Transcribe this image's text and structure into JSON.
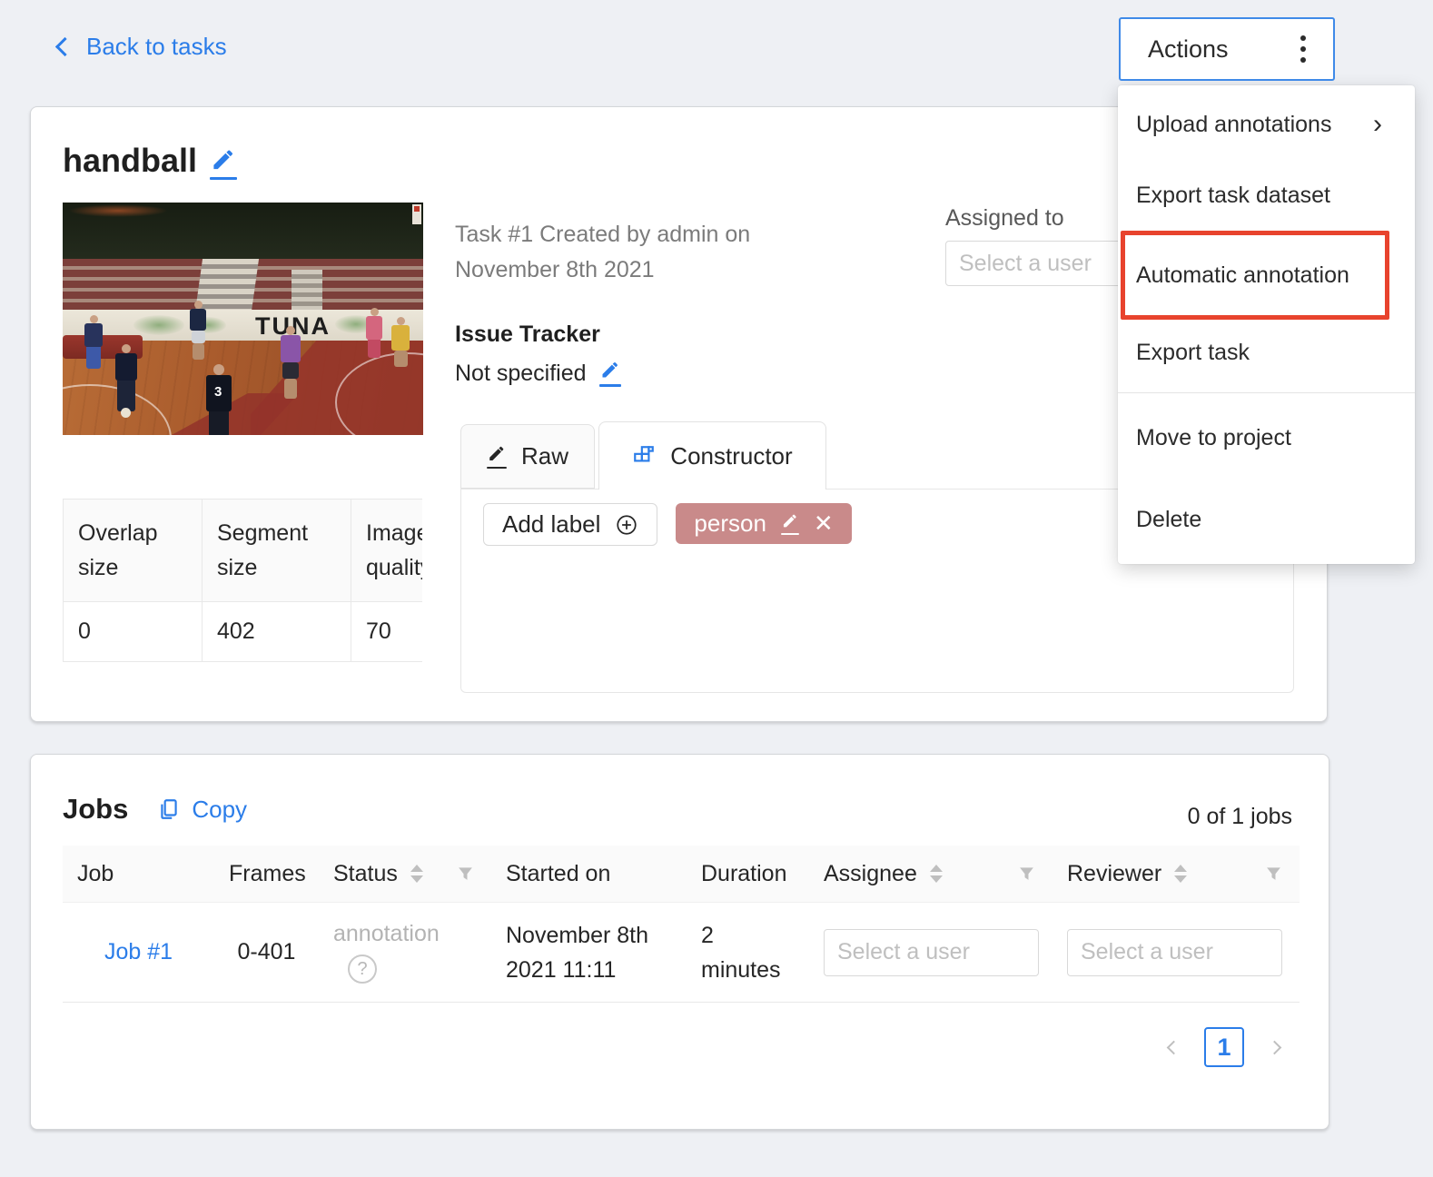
{
  "header": {
    "back_link": "Back to tasks",
    "actions_button": "Actions"
  },
  "actions_menu": {
    "highlight_color": "#e8432d",
    "highlighted_item": "Automatic annotation",
    "items": [
      {
        "label": "Upload annotations"
      },
      {
        "label": "Export task dataset"
      },
      {
        "label": "Automatic annotation"
      },
      {
        "label": "Export task"
      },
      {
        "label": "Move to project"
      },
      {
        "label": "Delete"
      }
    ]
  },
  "task": {
    "title": "handball",
    "created_line1": "Task #1 Created by admin on",
    "created_line2": "November 8th 2021",
    "assigned_to": {
      "label": "Assigned to",
      "placeholder": "Select a user"
    },
    "issue_tracker": {
      "label": "Issue Tracker",
      "value": "Not specified"
    },
    "preview": {
      "banner_text": "TUNA",
      "jersey_number": "3"
    },
    "tabs": {
      "raw": "Raw",
      "constructor": "Constructor"
    },
    "labels_panel": {
      "add_button": "Add label",
      "label_chip": "person",
      "chip_color": "#c98a8a"
    },
    "params_table": {
      "headers": [
        "Overlap size",
        "Segment size",
        "Image quality"
      ],
      "values": [
        "0",
        "402",
        "70"
      ]
    }
  },
  "jobs": {
    "title": "Jobs",
    "copy_button": "Copy",
    "summary": "0 of 1 jobs",
    "columns": [
      "Job",
      "Frames",
      "Status",
      "Started on",
      "Duration",
      "Assignee",
      "Reviewer"
    ],
    "row": {
      "job": "Job #1",
      "frames": "0-401",
      "status": "annotation",
      "started_on": "November 8th 2021 11:11",
      "duration": "2 minutes",
      "assignee_placeholder": "Select a user",
      "reviewer_placeholder": "Select a user"
    },
    "pagination": {
      "current_page": "1"
    }
  },
  "icons": {
    "help": "?",
    "close": "✕",
    "submenu_arrow": "›"
  }
}
